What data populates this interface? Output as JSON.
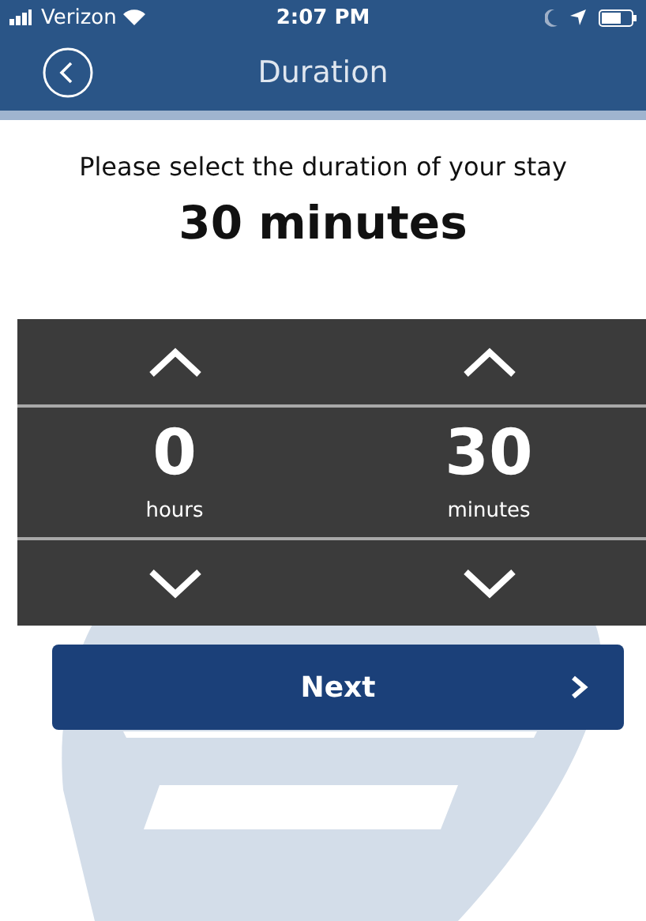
{
  "status_bar": {
    "carrier": "Verizon",
    "time": "2:07 PM"
  },
  "nav_bar": {
    "title": "Duration"
  },
  "prompt": "Please select the duration of your stay",
  "selected_duration": "30 minutes",
  "pickers": [
    {
      "value": "0",
      "unit": "hours"
    },
    {
      "value": "30",
      "unit": "minutes"
    }
  ],
  "next_button": {
    "label": "Next"
  }
}
